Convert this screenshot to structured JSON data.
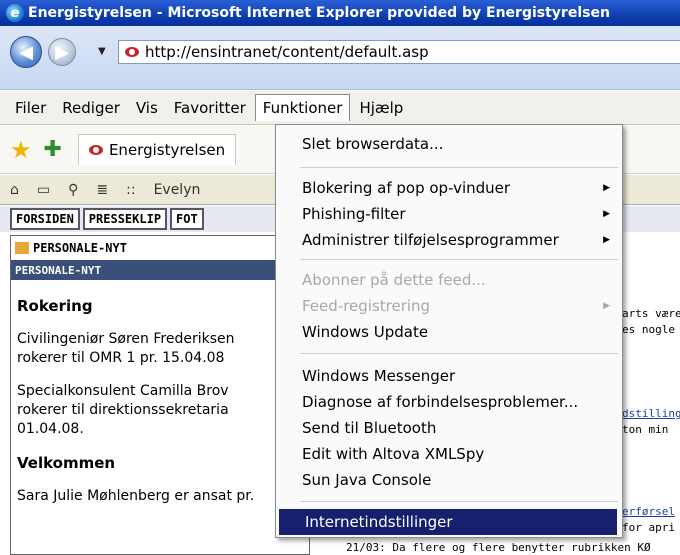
{
  "window": {
    "title": "Energistyrelsen - Microsoft Internet Explorer provided by Energistyrelsen"
  },
  "addressbar": {
    "url": "http://ensintranet/content/default.asp"
  },
  "menubar": {
    "items": [
      "Filer",
      "Rediger",
      "Vis",
      "Favoritter",
      "Funktioner",
      "Hjælp"
    ],
    "active": "Funktioner"
  },
  "favbar": {
    "tab_label": "Energistyrelsen"
  },
  "toolstrip": {
    "user": "Evelyn"
  },
  "navstrip": {
    "items": [
      "FORSIDEN",
      "PRESSEKLIP",
      "FOT"
    ]
  },
  "left_panel": {
    "header1": "PERSONALE-NYT",
    "header2": "PERSONALE-NYT",
    "section1_title": "Rokering",
    "p1_line1": "Civilingeniør Søren Frederiksen",
    "p1_line2": "rokerer til OMR 1 pr. 15.04.08",
    "p2_line1": "Specialkonsulent Camilla Brov",
    "p2_line2": "rokerer til direktionssekretaria",
    "p2_line3": "01.04.08.",
    "section2_title": "Velkommen",
    "p3_line1": "Sara Julie Møhlenberg er ansat pr."
  },
  "right_panel": {
    "l1": "arts være",
    "l2": "es nogle",
    "l3": "dstilling",
    "l4": "ton min",
    "l5": "erførsel",
    "l6": "for apri",
    "footer": "21/03: Da flere og flere benytter rubrikken KØ"
  },
  "tools_menu": {
    "items": [
      {
        "label": "Slet browserdata...",
        "disabled": false,
        "submenu": false
      },
      {
        "label": "Blokering af pop op-vinduer",
        "disabled": false,
        "submenu": true
      },
      {
        "label": "Phishing-filter",
        "disabled": false,
        "submenu": true
      },
      {
        "label": "Administrer tilføjelsesprogrammer",
        "disabled": false,
        "submenu": true
      },
      {
        "label": "Abonner på dette feed...",
        "disabled": true,
        "submenu": false
      },
      {
        "label": "Feed-registrering",
        "disabled": true,
        "submenu": true
      },
      {
        "label": "Windows Update",
        "disabled": false,
        "submenu": false
      },
      {
        "label": "Windows Messenger",
        "disabled": false,
        "submenu": false
      },
      {
        "label": "Diagnose af forbindelsesproblemer...",
        "disabled": false,
        "submenu": false
      },
      {
        "label": "Send til Bluetooth",
        "disabled": false,
        "submenu": false
      },
      {
        "label": "Edit with Altova XMLSpy",
        "disabled": false,
        "submenu": false
      },
      {
        "label": "Sun Java Console",
        "disabled": false,
        "submenu": false
      },
      {
        "label": "Internetindstillinger",
        "disabled": false,
        "submenu": false
      }
    ],
    "selected": "Internetindstillinger"
  },
  "colors": {
    "titlebar": "#0a3aa8",
    "menu_highlight": "#17206e",
    "link": "#1a3ea8"
  }
}
